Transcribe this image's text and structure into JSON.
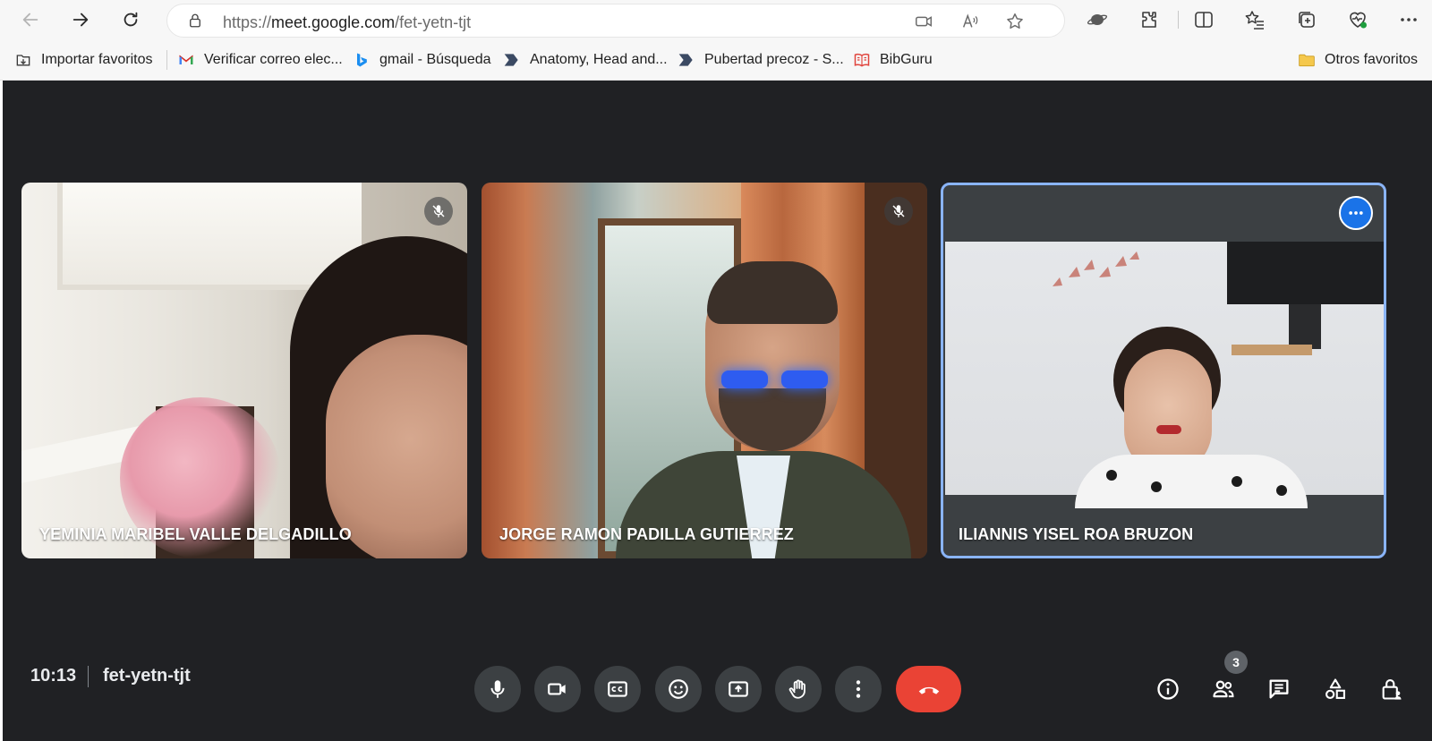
{
  "browser": {
    "url_scheme": "https://",
    "url_host": "meet.google.com",
    "url_path": "/fet-yetn-tjt"
  },
  "favorites": {
    "items": [
      {
        "label": "Importar favoritos",
        "icon": "import-icon"
      },
      {
        "label": "Verificar correo elec...",
        "icon": "gmail-icon"
      },
      {
        "label": "gmail - Búsqueda",
        "icon": "bing-icon"
      },
      {
        "label": "Anatomy, Head and...",
        "icon": "bookmark-arrow-icon"
      },
      {
        "label": "Pubertad precoz - S...",
        "icon": "bookmark-arrow-icon"
      },
      {
        "label": "BibGuru",
        "icon": "book-icon"
      }
    ],
    "other_label": "Otros favoritos"
  },
  "meeting": {
    "time": "10:13",
    "code": "fet-yetn-tjt",
    "participant_count": "3",
    "participants": [
      {
        "name": "YEMINIA MARIBEL VALLE DELGADILLO",
        "muted": true
      },
      {
        "name": "JORGE RAMON PADILLA GUTIERREZ",
        "muted": true
      },
      {
        "name": "ILIANNIS YISEL ROA BRUZON",
        "muted": false,
        "active_speaker": true
      }
    ]
  },
  "colors": {
    "background": "#202124",
    "control": "#3c4043",
    "end_call": "#ea4335",
    "accent": "#1a73e8",
    "active_border": "#8ab4f8"
  }
}
